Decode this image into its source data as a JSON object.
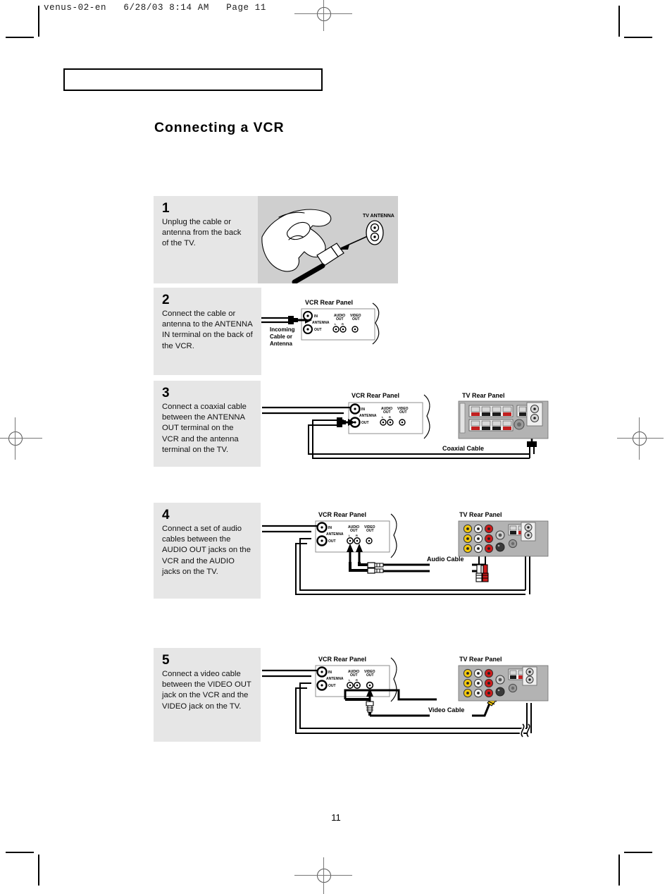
{
  "document": {
    "pdf_header": "venus-02-en   6/28/03 8:14 AM   Page 11",
    "title": "Connecting a VCR",
    "page_number": "11",
    "chapter_box_text": ""
  },
  "labels": {
    "vcr_rear_panel": "VCR  Rear  Panel",
    "tv_rear_panel": "TV  Rear  Panel",
    "tv_antenna": "TV ANTENNA",
    "incoming_cable_line1": "Incoming",
    "incoming_cable_line2": "Cable  or",
    "incoming_cable_line3": "Antenna",
    "antenna": "ANTENNA",
    "in": "IN",
    "out": "OUT",
    "audio": "AUDIO",
    "audio_out_line2": "OUT",
    "video": "VIDEO",
    "video_out_line2": "OUT",
    "ch_l": "L",
    "ch_r": "R",
    "coaxial_cable": "Coaxial  Cable",
    "audio_cable": "Audio  Cable",
    "video_cable": "Video  Cable"
  },
  "colors": {
    "step_background": "#e6e6e6",
    "figure_background": "#ffffff",
    "figure_shaded": "#cfcfcf",
    "panel_gray": "#b3b3b3",
    "panel_dark": "#8a8a8a",
    "jack_yellow": "#f2c80f",
    "jack_red": "#cc1b1b",
    "jack_white": "#f2f2f2",
    "ink": "#000000"
  },
  "steps": [
    {
      "number": "1",
      "text": "Unplug the cable or antenna from the back of the TV.",
      "figure": "hand-unplugging-antenna"
    },
    {
      "number": "2",
      "text": "Connect the cable or antenna to the ANTENNA IN terminal on the back of the VCR.",
      "figure": "vcr-antenna-in"
    },
    {
      "number": "3",
      "text": "Connect a coaxial cable between the ANTENNA OUT terminal on the VCR and the antenna terminal on the TV.",
      "figure": "vcr-to-tv-coaxial"
    },
    {
      "number": "4",
      "text": "Connect a set of audio cables between the AUDIO OUT jacks on the VCR and the AUDIO jacks on the TV.",
      "figure": "vcr-to-tv-audio"
    },
    {
      "number": "5",
      "text": "Connect a video cable between the VIDEO OUT jack on the VCR and the VIDEO jack on the TV.",
      "figure": "vcr-to-tv-video"
    }
  ]
}
